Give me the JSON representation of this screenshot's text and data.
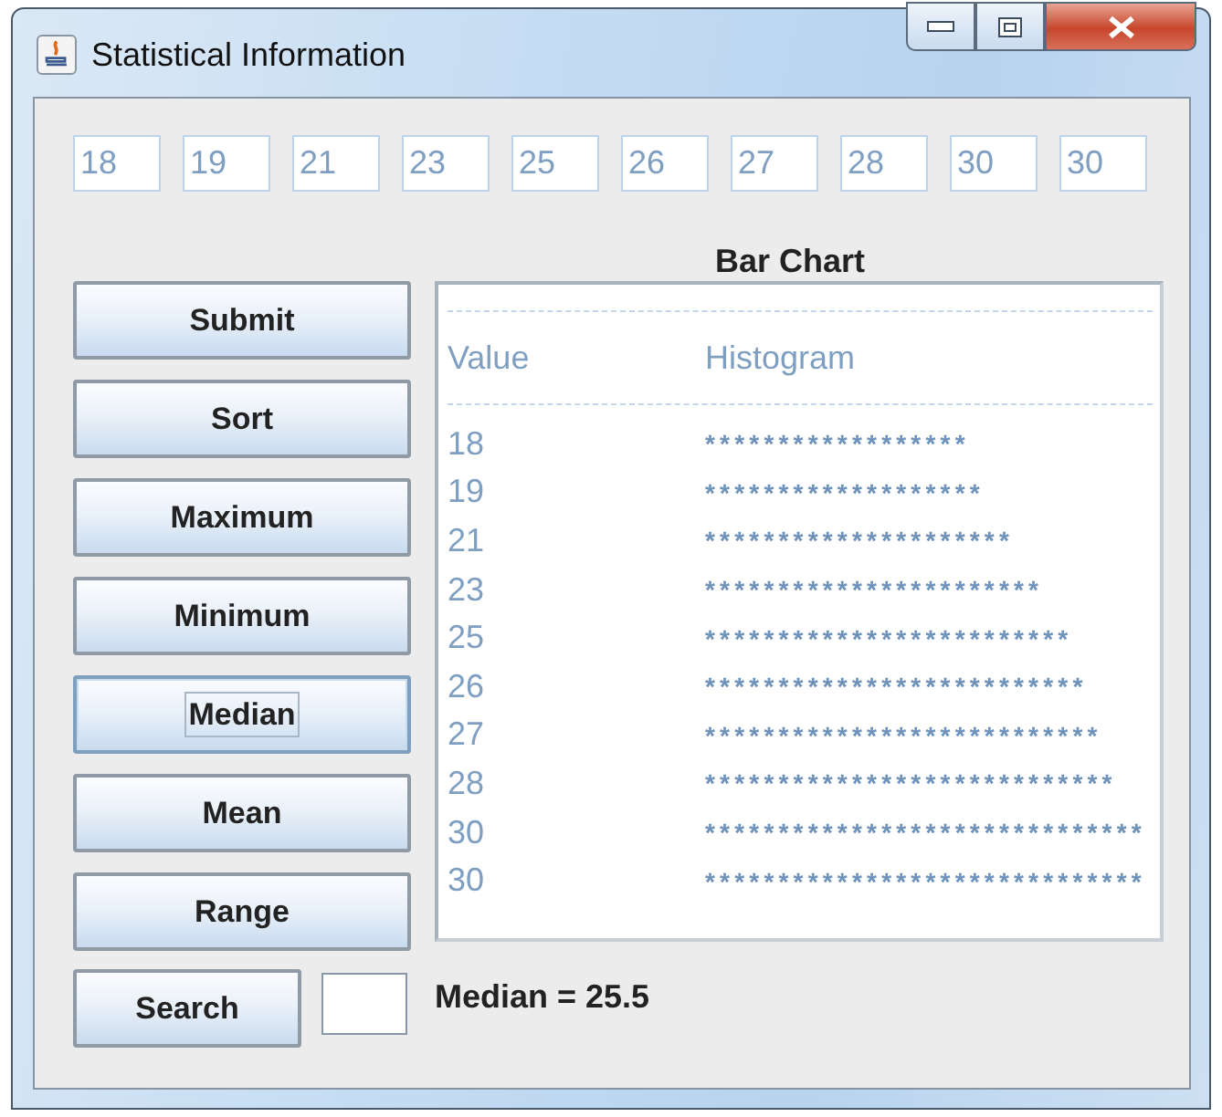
{
  "window": {
    "title": "Statistical Information"
  },
  "inputs": [
    "18",
    "19",
    "21",
    "23",
    "25",
    "26",
    "27",
    "28",
    "30",
    "30"
  ],
  "buttons": [
    {
      "label": "Submit",
      "focused": false
    },
    {
      "label": "Sort",
      "focused": false
    },
    {
      "label": "Maximum",
      "focused": false
    },
    {
      "label": "Minimum",
      "focused": false
    },
    {
      "label": "Median",
      "focused": true
    },
    {
      "label": "Mean",
      "focused": false
    },
    {
      "label": "Range",
      "focused": false
    }
  ],
  "chart": {
    "title": "Bar Chart",
    "columns": [
      "Value",
      "Histogram"
    ],
    "rows": [
      {
        "value": "18",
        "bar": "******************"
      },
      {
        "value": "19",
        "bar": "*******************"
      },
      {
        "value": "21",
        "bar": "*********************"
      },
      {
        "value": "23",
        "bar": "***********************"
      },
      {
        "value": "25",
        "bar": "*************************"
      },
      {
        "value": "26",
        "bar": "**************************"
      },
      {
        "value": "27",
        "bar": "***************************"
      },
      {
        "value": "28",
        "bar": "****************************"
      },
      {
        "value": "30",
        "bar": "******************************"
      },
      {
        "value": "30",
        "bar": "******************************"
      }
    ]
  },
  "search": {
    "button": "Search"
  },
  "result": "Median = 25.5"
}
